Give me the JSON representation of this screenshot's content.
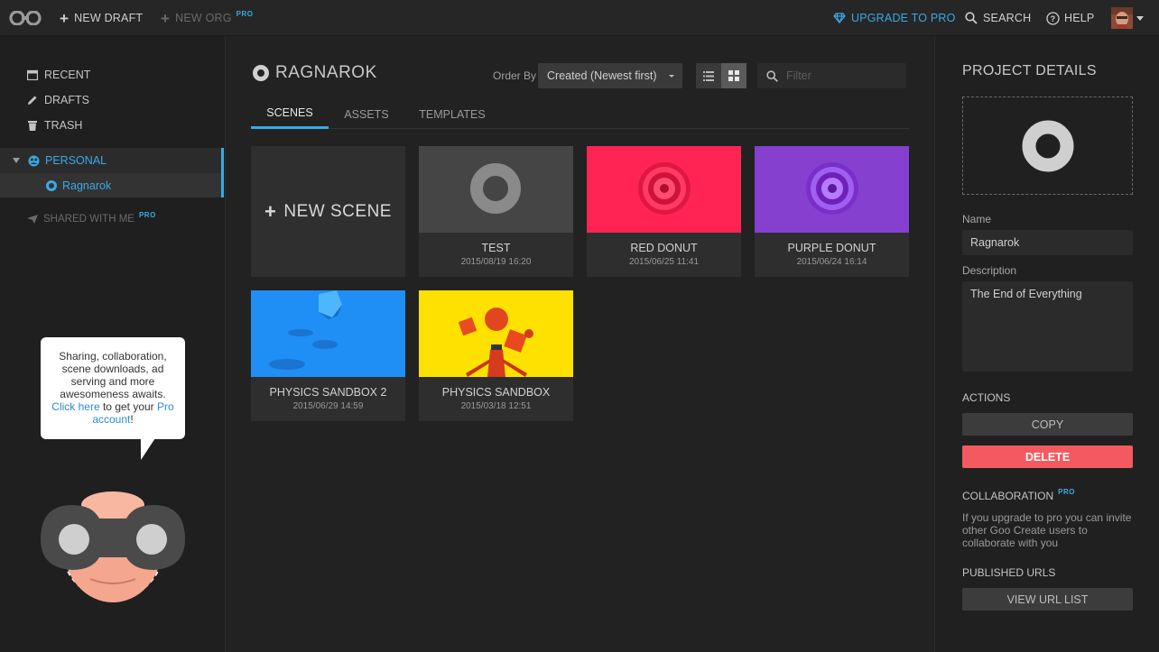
{
  "topbar": {
    "new_draft": "NEW DRAFT",
    "new_org": "NEW ORG",
    "pro_badge": "PRO",
    "upgrade": "UPGRADE TO PRO",
    "search": "SEARCH",
    "help": "HELP"
  },
  "sidebar": {
    "recent": "RECENT",
    "drafts": "DRAFTS",
    "trash": "TRASH",
    "personal": "PERSONAL",
    "project": "Ragnarok",
    "shared": "SHARED WITH ME",
    "pro_badge": "PRO",
    "promo": {
      "text1": "Sharing, collaboration, scene downloads, ad serving and more awesomeness awaits.",
      "link1": "Click here",
      "text2": " to get your",
      "link2": "Pro account",
      "text3": "!"
    }
  },
  "main": {
    "title": "RAGNAROK",
    "order_by_label": "Order By",
    "order_by_value": "Created (Newest first)",
    "filter_placeholder": "Filter",
    "tabs": [
      "SCENES",
      "ASSETS",
      "TEMPLATES"
    ],
    "new_scene": "NEW SCENE",
    "scenes": [
      {
        "name": "TEST",
        "date": "2015/08/19 16:20"
      },
      {
        "name": "RED DONUT",
        "date": "2015/06/25 11:41"
      },
      {
        "name": "PURPLE DONUT",
        "date": "2015/06/24 16:14"
      },
      {
        "name": "PHYSICS SANDBOX 2",
        "date": "2015/06/29 14:59"
      },
      {
        "name": "PHYSICS SANDBOX",
        "date": "2015/03/18 12:51"
      }
    ]
  },
  "details": {
    "title": "PROJECT DETAILS",
    "name_label": "Name",
    "name_value": "Ragnarok",
    "description_label": "Description",
    "description_value": "The End of Everything",
    "actions_label": "ACTIONS",
    "copy": "COPY",
    "delete": "DELETE",
    "collaboration_label": "COLLABORATION",
    "pro_badge": "PRO",
    "collaboration_text": "If you upgrade to pro you can invite other Goo Create users to collaborate with you",
    "published_label": "PUBLISHED URLS",
    "view_url_list": "VIEW URL LIST"
  },
  "colors": {
    "accent": "#3aa9e6",
    "delete": "#f25a5f",
    "red_donut_bg": "#ff2453",
    "purple_donut_bg": "#8540d0",
    "sandbox2_bg": "#1b90ff",
    "sandbox_bg": "#ffdf00"
  }
}
